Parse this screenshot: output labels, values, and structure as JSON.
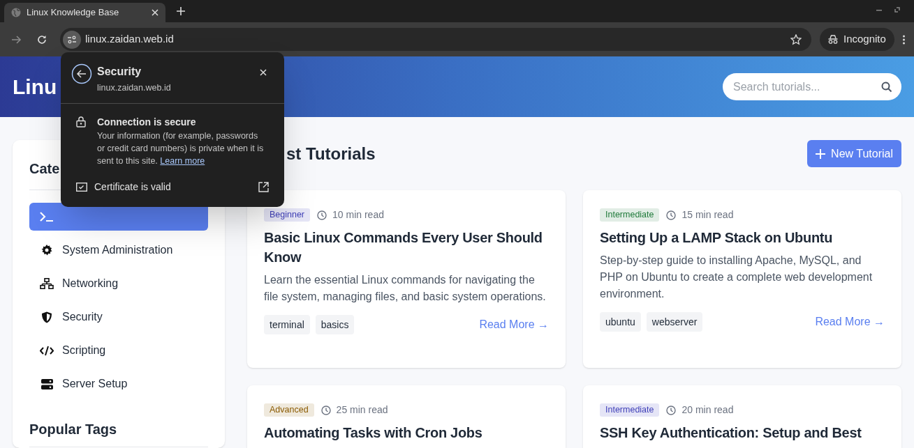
{
  "browser": {
    "tab": {
      "title": "Linux Knowledge Base"
    },
    "address": "linux.zaidan.web.id",
    "profile": "Incognito"
  },
  "header": {
    "title": "Linu",
    "search": {
      "placeholder": "Search tutorials..."
    }
  },
  "security_popup": {
    "title": "Security",
    "site": "linux.zaidan.web.id",
    "connection_title": "Connection is secure",
    "connection_text": "Your information (for example, passwords or credit card numbers) is private when it is sent to this site.",
    "link": "Learn more",
    "certificate": "Certificate is valid"
  },
  "sidebar": {
    "heading": "Cate",
    "items": [
      {
        "kind": "terminal",
        "selected": true
      },
      {
        "kind": "gear",
        "label": "System Administration",
        "selected": false
      },
      {
        "kind": "network",
        "label": "Networking",
        "selected": false
      },
      {
        "kind": "shield",
        "label": "Security",
        "selected": false
      },
      {
        "kind": "code",
        "label": "Scripting",
        "selected": false
      },
      {
        "kind": "server",
        "label": "Server Setup",
        "selected": false
      }
    ],
    "tags_heading": "Popular Tags"
  },
  "main": {
    "heading": "st Tutorials",
    "new_button": "New Tutorial",
    "cards": [
      {
        "level": "Beginner",
        "color": "#3f3fb8",
        "read_time": "10 min read",
        "title": "Basic Linux Commands Every User Should Know",
        "description": "Learn the essential Linux commands for navigating the file system, managing files, and basic system operations.",
        "tags": [
          "terminal",
          "basics"
        ],
        "link": "Read More →"
      },
      {
        "level": "Intermediate",
        "color": "#1f7a3a",
        "read_time": "15 min read",
        "title": "Setting Up a LAMP Stack on Ubuntu",
        "description": "Step-by-step guide to installing Apache, MySQL, and PHP on Ubuntu to create a complete web development environment.",
        "tags": [
          "ubuntu",
          "webserver"
        ],
        "link": "Read More →"
      },
      {
        "level": "Advanced",
        "color": "#8a5a00",
        "read_time": "25 min read",
        "title": "Automating Tasks with Cron Jobs"
      },
      {
        "level": "Intermediate",
        "color": "#3f3fb8",
        "read_time": "20 min read",
        "title": "SSH Key Authentication: Setup and Best"
      }
    ]
  }
}
